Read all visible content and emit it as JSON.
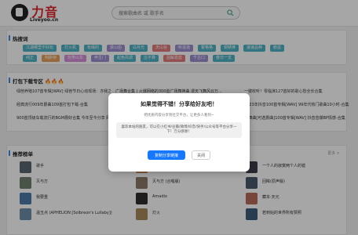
{
  "logo": {
    "title": "力音",
    "subtitle": "Liveyoo.cn"
  },
  "search": {
    "placeholder": "搜索歌曲名 或 歌手名"
  },
  "hot_search": {
    "title": "热搜词",
    "tags": [
      {
        "label": "江湖哪里不好玩",
        "color": "#4fb3c6"
      },
      {
        "label": "打火机",
        "color": "#4fb3c6"
      },
      {
        "label": "有缘的",
        "color": "#4fb3c6"
      },
      {
        "label": "梁山伯",
        "color": "#9b8fd0"
      },
      {
        "label": "白月光",
        "color": "#4fb3c6"
      },
      {
        "label": "天山谷",
        "color": "#e27c7c"
      },
      {
        "label": "听说道",
        "color": "#9b8fd0"
      },
      {
        "label": "霍格格",
        "color": "#4fb3c6"
      },
      {
        "label": "铜锈棒",
        "color": "#4fb3c6"
      },
      {
        "label": "速速品种",
        "color": "#4fb3c6"
      },
      {
        "label": "鹅蛋",
        "color": "#4fb3c6"
      },
      {
        "label": "纯正",
        "color": "#4fb3c6"
      },
      {
        "label": "明斯特",
        "color": "#e9a05a"
      },
      {
        "label": "玩笑山东",
        "color": "#d48fd8"
      },
      {
        "label": "养生门",
        "color": "#9b8fd0"
      },
      {
        "label": "起色风调",
        "color": "#4fb3c6"
      },
      {
        "label": "古不算",
        "color": "#4fb3c6"
      },
      {
        "label": "因解嘉蓝",
        "color": "#e27c7c"
      },
      {
        "label": "千古口",
        "color": "#9b8fd0"
      },
      {
        "label": "春日一支",
        "color": "#4fb3c6"
      }
    ]
  },
  "download": {
    "title": "打包下载专区",
    "rows": [
      [
        "绿芭养殖107首专辑[WAV] 绿芭节日心动现场：亦我之作-合集",
        "广场舞合集 | 火爆网络的300首广场舞神曲 漫天飞舞风云万...",
        "一键收听！零临演127首好的歌心愁全长合集"
      ],
      [
        "经典流行009年爵曲109首打包下载-合集",
        "",
        "2023年抖音100首专辑[WAV] 99年代热门歌曲10小时-合集"
      ],
      [
        "900首顶级车载流行的BGM爵好合集 今年至今分享 网络...",
        "",
        "DJ舞曲[可选爵曲]100首专辑[WAV] 抖音音爆BP情感-合集"
      ]
    ]
  },
  "recommend": {
    "title": "推荐榜单",
    "more": "更多 >",
    "items": [
      {
        "title": "歌手",
        "meta": "",
        "color": "#5b6770"
      },
      {
        "title": "",
        "meta": "",
        "color": "#c58a5a"
      },
      {
        "title": "一个人的寂寞两个人的错",
        "meta": "",
        "color": "#3e3e4a"
      },
      {
        "title": "灭与方",
        "meta": "",
        "color": "#72806d"
      },
      {
        "title": "灭与方 (合唱版)",
        "meta": "",
        "color": "#8a7a66"
      },
      {
        "title": "回眸(原声版)",
        "meta": "",
        "color": "#4b5a6e"
      },
      {
        "title": "我要重",
        "meta": "",
        "color": "#4a7ba8"
      },
      {
        "title": "Amadio",
        "meta": "",
        "color": "#2f2f2f"
      },
      {
        "title": "藏本·天元",
        "meta": "",
        "color": "#b86a5a"
      },
      {
        "title": "温玉点 (APHELION [Solbreon's Lullaby])",
        "meta": "",
        "color": "#6e8fa8"
      },
      {
        "title": "灯火",
        "meta": "",
        "color": "#a88b5a"
      },
      {
        "title": "若到始的世界所有赞照",
        "meta": "",
        "color": "#3d5f7a"
      }
    ]
  },
  "modal": {
    "title": "如果觉得不错！分享给好友吧！",
    "subtitle": "把优质内容分享到社交平台，让更多人看到~",
    "body": "喜欢本站的朋友，可以在小红书/豆瓣/微博/抖音/快手/公众号等平台分享一下！万分感谢！",
    "copy_button": "复制分享链接",
    "close_button": "关闭"
  }
}
